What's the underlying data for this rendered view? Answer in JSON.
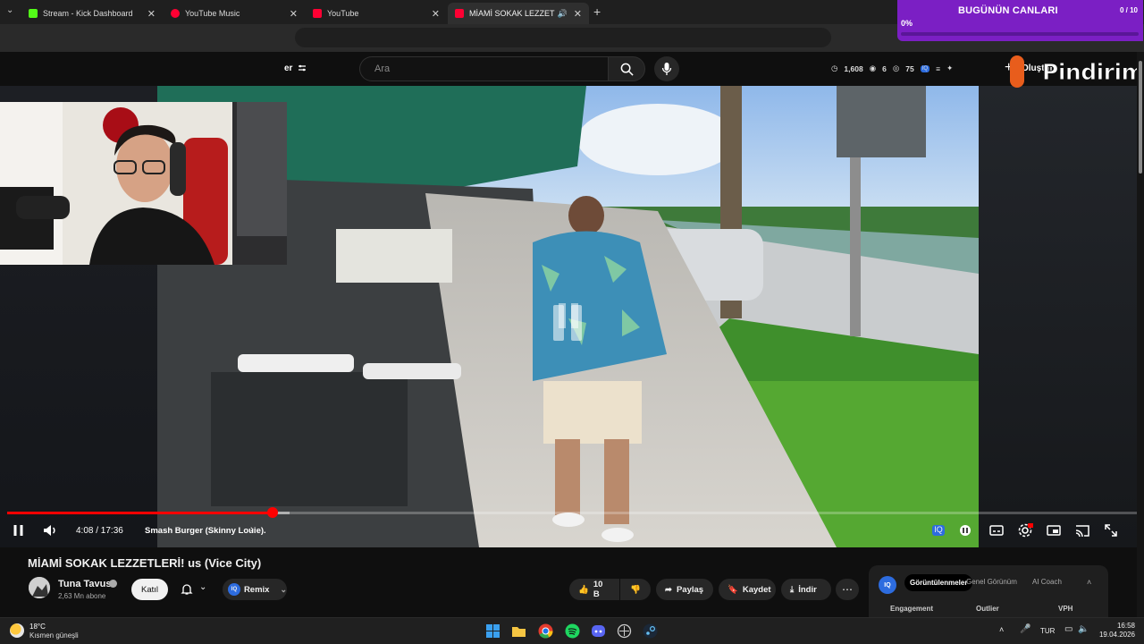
{
  "browser": {
    "tabs": [
      {
        "label": "Stream - Kick Dashboard",
        "color": "#53fc18"
      },
      {
        "label": "YouTube Music",
        "color": "#ff0033"
      },
      {
        "label": "YouTube",
        "color": "#ff0033"
      },
      {
        "label": "MİAMİ SOKAK LEZZETLERİ",
        "color": "#ff0033",
        "active": true
      }
    ],
    "new_tab": "+",
    "tab_menu": "⌄"
  },
  "masthead": {
    "filter_label": "er",
    "search_placeholder": "Ara",
    "stats": {
      "views": "1,608",
      "likes": "6",
      "watchers": "75"
    },
    "create_label": "Oluştur"
  },
  "stream_overlay": {
    "counter_title": "BUGÜNÜN CANLARI",
    "counter_count": "0 / 10",
    "counter_percent": "0%",
    "counter_progress": 0,
    "brand": "Pindirim"
  },
  "player": {
    "time": "4:08 / 17:36",
    "chapter": "Smash Burger (Skinny Louie).",
    "played_fraction": 0.235,
    "buffered_fraction": 0.25,
    "state": "paused"
  },
  "video": {
    "title": "MİAMİ SOKAK LEZZETLERİ! us (Vice City)",
    "channel": "Tuna Tavus",
    "subscribers": "2,63 Mn abone",
    "join_label": "Katıl",
    "remix_label": "Remix",
    "like_count": "10 B",
    "share_label": "Paylaş",
    "save_label": "Kaydet",
    "download_label": "İndir"
  },
  "analytics_panel": {
    "logo": "IQ",
    "tabs": [
      "Görüntülenmeler",
      "Genel Görünüm",
      "AI Coach"
    ],
    "headers": [
      "Engagement",
      "Outlier",
      "VPH"
    ]
  },
  "taskbar": {
    "weather_temp": "18°C",
    "weather_desc": "Kısmen güneşli",
    "lang": "TUR",
    "time": "16:58",
    "date": "19.04.2026"
  }
}
